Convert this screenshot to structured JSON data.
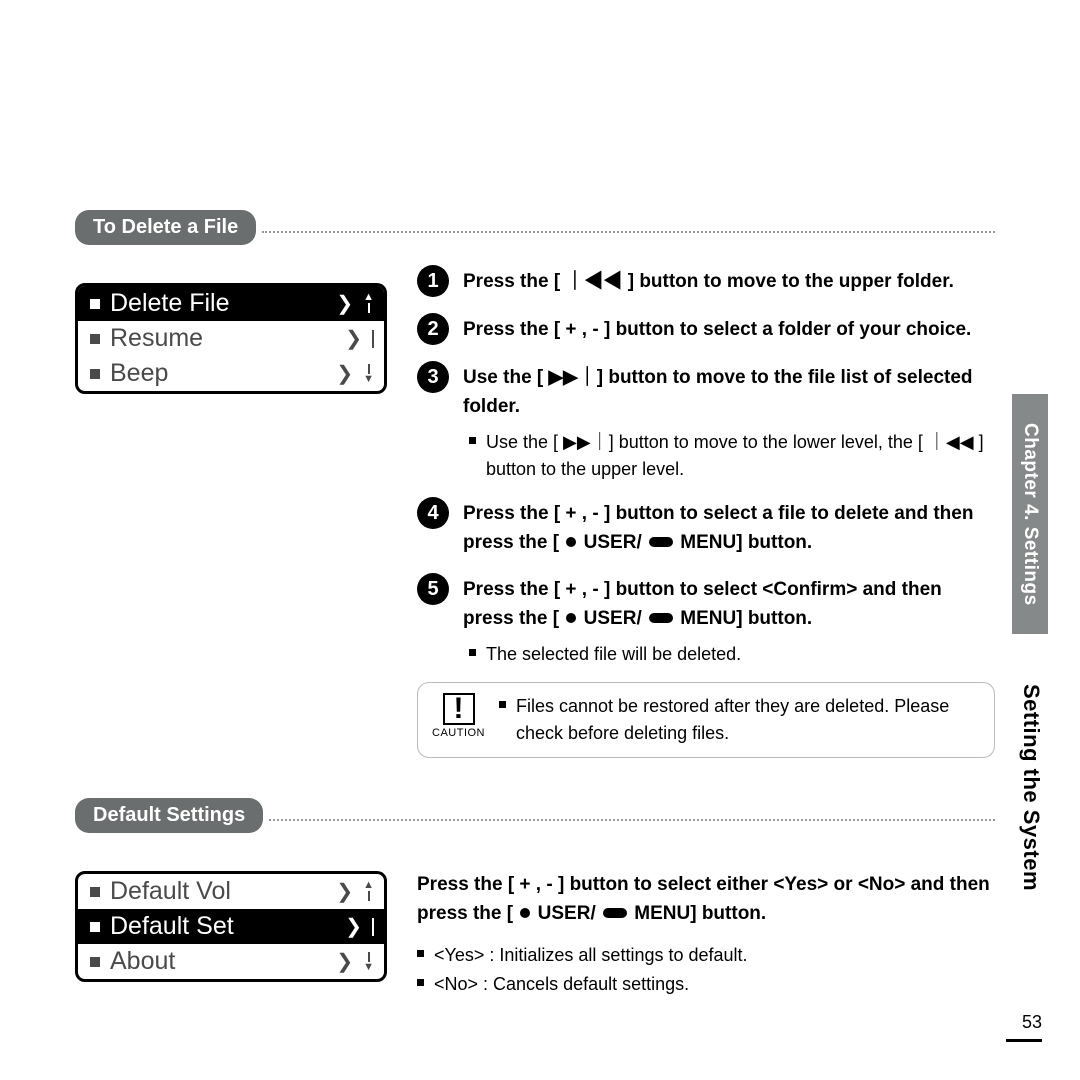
{
  "sidebar": {
    "chapter": "Chapter 4. Settings",
    "section": "Setting the System"
  },
  "pageNumber": "53",
  "section1": {
    "heading": "To Delete a File",
    "screen": {
      "items": [
        {
          "label": "Delete File",
          "highlight": true
        },
        {
          "label": "Resume",
          "highlight": false
        },
        {
          "label": "Beep",
          "highlight": false
        }
      ]
    },
    "steps": {
      "s1": "Press the [ ｜◀◀ ] button to move to the upper folder.",
      "s2": "Press the [ + , - ] button to select a folder of your choice.",
      "s3": "Use the [ ▶▶｜] button to move to the file list of selected folder.",
      "s3sub": "Use the [ ▶▶｜] button to move to the lower level, the [ ｜◀◀ ] button to the upper level.",
      "s4a": "Press the [ + , - ] button to select a file to delete and then press the [ ",
      "s4b": " USER/ ",
      "s4c": " MENU] button.",
      "s5a": "Press the [ + , - ] button to select <Confirm> and then press the [ ",
      "s5b": " USER/ ",
      "s5c": " MENU] button.",
      "s5sub": "The selected file will be deleted."
    },
    "caution": {
      "label": "CAUTION",
      "text": "Files cannot be restored after they are deleted. Please check before deleting files."
    }
  },
  "section2": {
    "heading": "Default Settings",
    "screen": {
      "items": [
        {
          "label": "Default Vol",
          "highlight": false
        },
        {
          "label": "Default Set",
          "highlight": true
        },
        {
          "label": "About",
          "highlight": false
        }
      ]
    },
    "body": {
      "mainA": "Press the [ + , - ] button to select either <Yes> or <No> and then press the [ ",
      "mainB": " USER/ ",
      "mainC": " MENU] button.",
      "sub1": "<Yes> :  Initializes all settings to default.",
      "sub2": "<No> : Cancels default settings."
    }
  }
}
